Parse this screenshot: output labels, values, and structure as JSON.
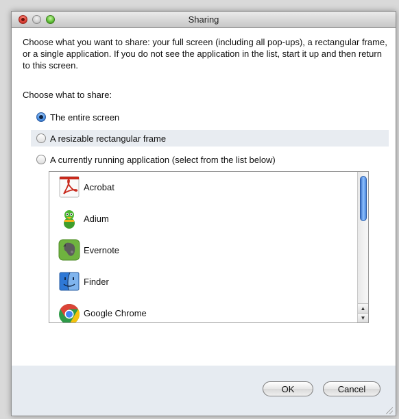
{
  "window": {
    "title": "Sharing"
  },
  "description": "Choose what you want to share:  your full screen (including all pop-ups), a rectangular frame, or a single application.  If you do not see the application in the list, start it up and then return to this screen.",
  "choose_label": "Choose what to share:",
  "options": [
    {
      "label": "The entire screen",
      "selected": true
    },
    {
      "label": "A resizable rectangular frame",
      "selected": false
    },
    {
      "label": "A currently running application (select from the list below)",
      "selected": false
    }
  ],
  "applications": [
    {
      "name": "Acrobat",
      "icon": "acrobat-icon"
    },
    {
      "name": "Adium",
      "icon": "adium-icon"
    },
    {
      "name": "Evernote",
      "icon": "evernote-icon"
    },
    {
      "name": "Finder",
      "icon": "finder-icon"
    },
    {
      "name": "Google Chrome",
      "icon": "chrome-icon"
    }
  ],
  "buttons": {
    "ok": "OK",
    "cancel": "Cancel"
  },
  "colors": {
    "selection_blue": "#4b8fe0",
    "footer_bg": "#e6ebf1"
  }
}
